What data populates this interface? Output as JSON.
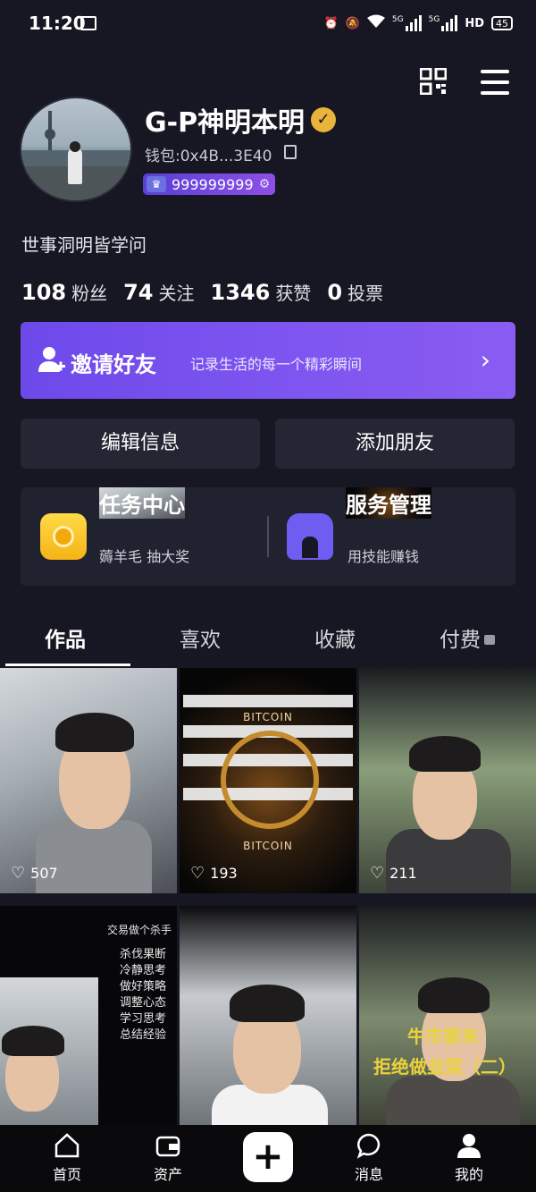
{
  "status_bar": {
    "time": "11:20",
    "network_1": "5G",
    "network_2": "5G",
    "hd": "HD",
    "battery": "45",
    "icons": [
      "message-icon",
      "alarm-icon",
      "mute-icon",
      "wifi-icon",
      "signal-icon",
      "battery-icon"
    ]
  },
  "header": {
    "icons": [
      "qr-code-icon",
      "menu-icon"
    ]
  },
  "profile": {
    "name": "G-P神明本明",
    "verified_icon": "verified-check-icon",
    "wallet": "钱包:0x4B...3E40",
    "badge_value": "999999999",
    "bio": "世事洞明皆学问",
    "stats": [
      {
        "value": "108",
        "label": "粉丝"
      },
      {
        "value": "74",
        "label": "关注"
      },
      {
        "value": "1346",
        "label": "获赞"
      },
      {
        "value": "0",
        "label": "投票"
      }
    ]
  },
  "invite": {
    "title": "邀请好友",
    "subtitle": "记录生活的每一个精彩瞬间",
    "chevron": "›"
  },
  "actions": {
    "edit": "编辑信息",
    "add_friend": "添加朋友"
  },
  "services": [
    {
      "title": "任务中心",
      "subtitle": "薅羊毛 抽大奖",
      "icon": "task-coin-icon"
    },
    {
      "title": "服务管理",
      "subtitle": "用技能赚钱",
      "icon": "shop-icon"
    }
  ],
  "tabs": [
    "作品",
    "喜欢",
    "收藏",
    "付费"
  ],
  "posts": [
    {
      "likes": "507"
    },
    {
      "likes": "193",
      "text_top": "BITCOIN",
      "text_bottom": "BITCOIN"
    },
    {
      "likes": "211"
    },
    {
      "title": "交易做个杀手",
      "lines": [
        "杀伐果断",
        "冷静思考",
        "做好策略",
        "调整心态",
        "学习思考",
        "总结经验"
      ]
    },
    {},
    {
      "caption_1": "牛市要来",
      "caption_2": "拒绝做韭菜（二）"
    }
  ],
  "nav": {
    "home": "首页",
    "assets": "资产",
    "plus": "+",
    "messages": "消息",
    "me": "我的"
  },
  "colors": {
    "background": "#161722",
    "accent_purple": "#7e55f0",
    "card": "#252633",
    "gold": "#e8b43a"
  }
}
